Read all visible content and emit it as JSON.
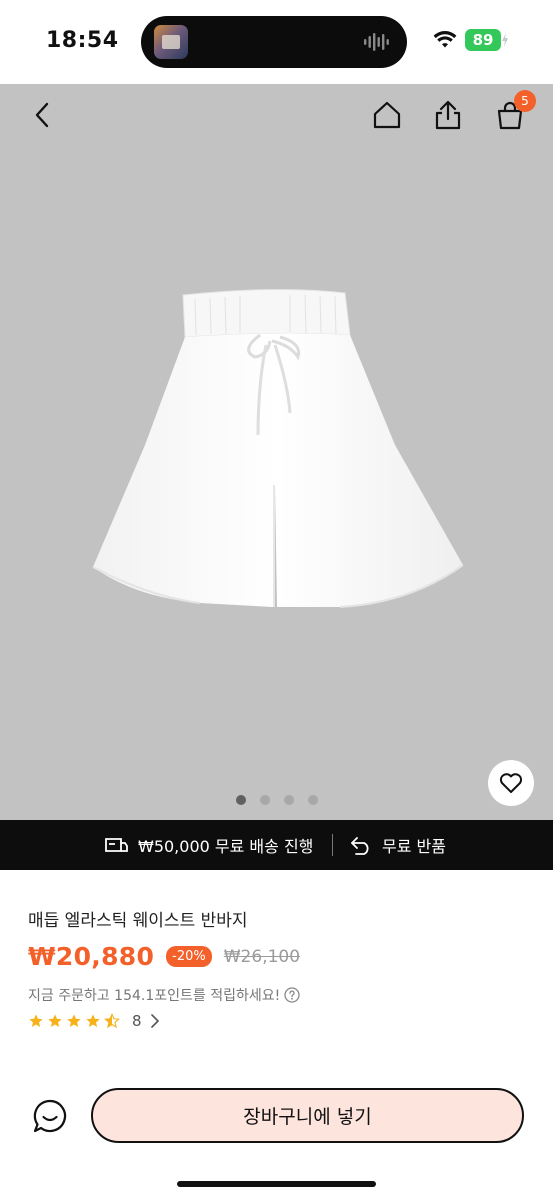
{
  "status_bar": {
    "time": "18:54",
    "battery": "89"
  },
  "header": {
    "cart_count": "5"
  },
  "icons": {
    "back": "chevron-left-icon",
    "home": "home-icon",
    "share": "share-icon",
    "cart": "shopping-bag-icon",
    "wishlist": "heart-icon",
    "shipping": "delivery-truck-icon",
    "return": "return-arrow-icon",
    "chat": "chat-bubble-icon",
    "help": "question-circle-icon",
    "star": "star-icon"
  },
  "carousel": {
    "count": 4,
    "active_index": 0
  },
  "shipping_bar": {
    "free_shipping": "₩50,000 무료 배송 진행",
    "free_return": "무료 반품"
  },
  "product": {
    "title": "매듭 엘라스틱 웨이스트 반바지",
    "price": "₩20,880",
    "discount": "-20%",
    "original_price": "₩26,100",
    "points_text": "지금 주문하고 154.1포인트를 적립하세요!",
    "rating": 4.5,
    "review_count": "8"
  },
  "actions": {
    "add_to_cart": "장바구니에 넣기"
  },
  "colors": {
    "accent": "#f3602a",
    "star": "#f6b21a",
    "button_bg": "#fde4dd",
    "image_bg": "#c2c2c2"
  }
}
